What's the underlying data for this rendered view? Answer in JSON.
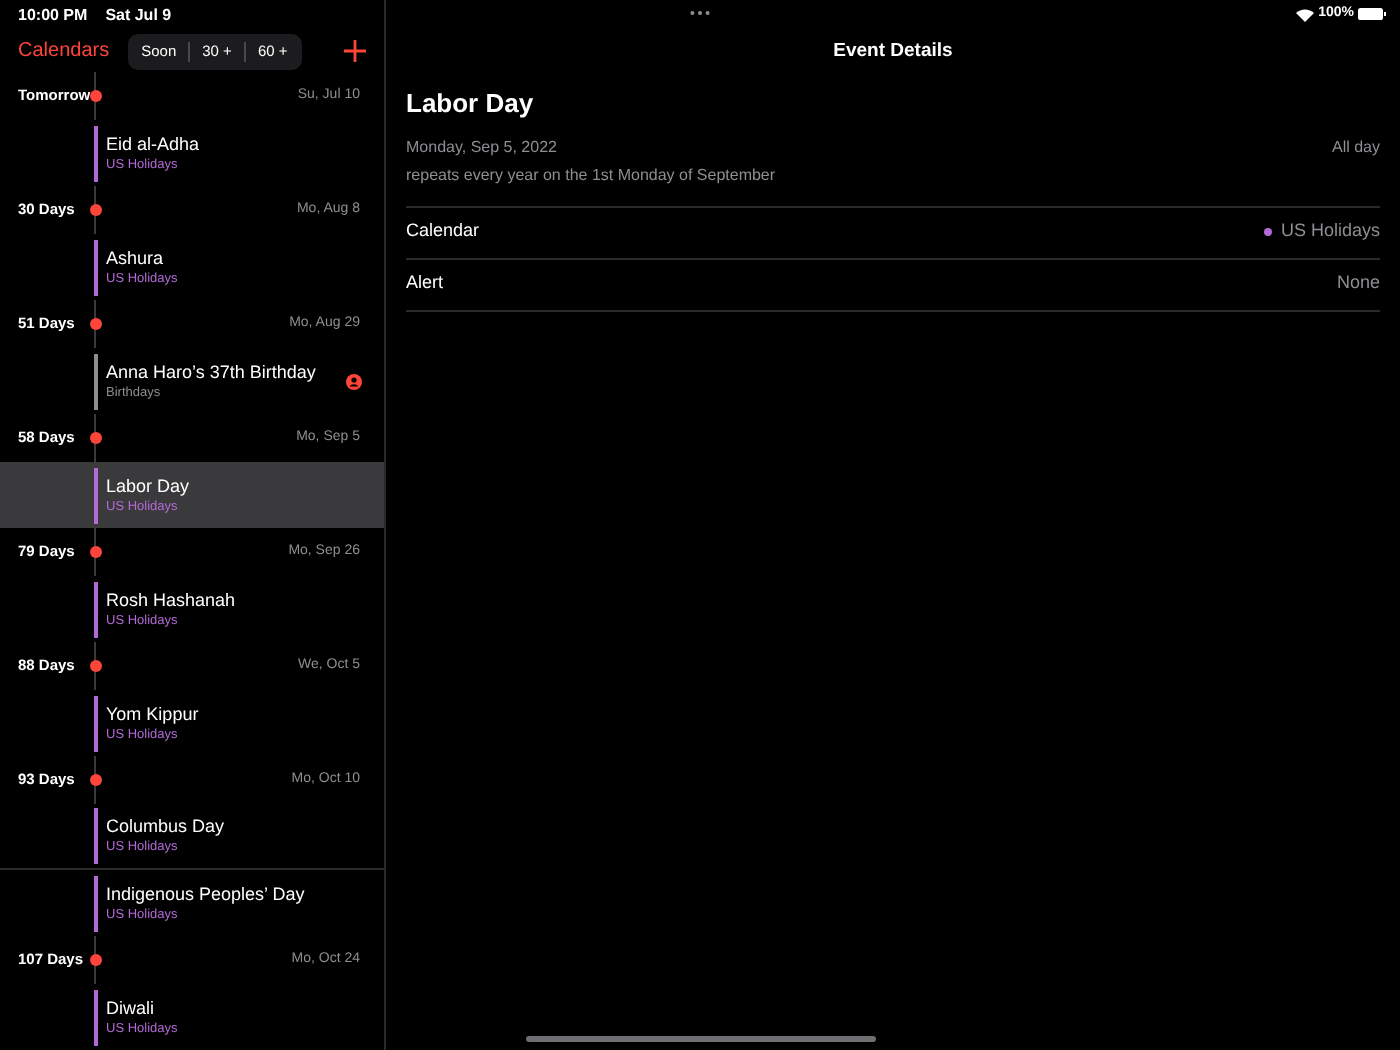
{
  "status_bar": {
    "time": "10:00 PM",
    "date": "Sat Jul 9",
    "battery": "100%"
  },
  "sidebar": {
    "title": "Calendars",
    "segments": [
      {
        "label": "Soon",
        "selected": false
      },
      {
        "label": "30 +",
        "selected": false
      },
      {
        "label": "60 +",
        "selected": false
      }
    ],
    "sections": [
      {
        "label": "Tomorrow",
        "date": "Su, Jul 10",
        "events": [
          {
            "title": "Eid al-Adha",
            "calendar": "US Holidays",
            "color": "#b36ad6",
            "selected": false
          }
        ]
      },
      {
        "label": "30 Days",
        "date": "Mo, Aug 8",
        "events": [
          {
            "title": "Ashura",
            "calendar": "US Holidays",
            "color": "#b36ad6",
            "selected": false
          }
        ]
      },
      {
        "label": "51 Days",
        "date": "Mo, Aug 29",
        "events": [
          {
            "title": "Anna Haro’s 37th Birthday",
            "calendar": "Birthdays",
            "color": "#8e8e93",
            "selected": false,
            "kind": "birthday"
          }
        ]
      },
      {
        "label": "58 Days",
        "date": "Mo, Sep 5",
        "events": [
          {
            "title": "Labor Day",
            "calendar": "US Holidays",
            "color": "#b36ad6",
            "selected": true
          }
        ]
      },
      {
        "label": "79 Days",
        "date": "Mo, Sep 26",
        "events": [
          {
            "title": "Rosh Hashanah",
            "calendar": "US Holidays",
            "color": "#b36ad6",
            "selected": false
          }
        ]
      },
      {
        "label": "88 Days",
        "date": "We, Oct 5",
        "events": [
          {
            "title": "Yom Kippur",
            "calendar": "US Holidays",
            "color": "#b36ad6",
            "selected": false
          }
        ]
      },
      {
        "label": "93 Days",
        "date": "Mo, Oct 10",
        "events": [
          {
            "title": "Columbus Day",
            "calendar": "US Holidays",
            "color": "#b36ad6",
            "selected": false
          },
          {
            "title": "Indigenous Peoples’ Day",
            "calendar": "US Holidays",
            "color": "#b36ad6",
            "selected": false
          }
        ]
      },
      {
        "label": "107 Days",
        "date": "Mo, Oct 24",
        "events": [
          {
            "title": "Diwali",
            "calendar": "US Holidays",
            "color": "#b36ad6",
            "selected": false
          }
        ]
      }
    ]
  },
  "detail": {
    "nav_title": "Event Details",
    "title": "Labor Day",
    "date": "Monday, Sep 5, 2022",
    "recurrence": "repeats every year on the 1st Monday of September",
    "duration": "All day",
    "rows": [
      {
        "label": "Calendar",
        "value": "US Holidays",
        "color": "#b36ad6"
      },
      {
        "label": "Alert",
        "value": "None"
      }
    ]
  }
}
